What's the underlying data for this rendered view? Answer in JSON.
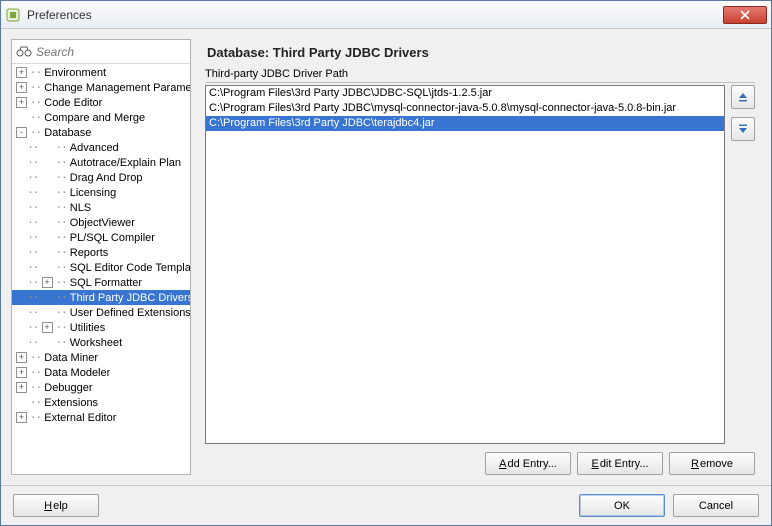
{
  "window": {
    "title": "Preferences"
  },
  "search": {
    "placeholder": "Search"
  },
  "tree": [
    {
      "label": "Environment",
      "level": 0,
      "exp": "+"
    },
    {
      "label": "Change Management Parameters",
      "level": 0,
      "exp": "+"
    },
    {
      "label": "Code Editor",
      "level": 0,
      "exp": "+"
    },
    {
      "label": "Compare and Merge",
      "level": 0,
      "exp": " "
    },
    {
      "label": "Database",
      "level": 0,
      "exp": "-"
    },
    {
      "label": "Advanced",
      "level": 1,
      "exp": " "
    },
    {
      "label": "Autotrace/Explain Plan",
      "level": 1,
      "exp": " "
    },
    {
      "label": "Drag And Drop",
      "level": 1,
      "exp": " "
    },
    {
      "label": "Licensing",
      "level": 1,
      "exp": " "
    },
    {
      "label": "NLS",
      "level": 1,
      "exp": " "
    },
    {
      "label": "ObjectViewer",
      "level": 1,
      "exp": " "
    },
    {
      "label": "PL/SQL Compiler",
      "level": 1,
      "exp": " "
    },
    {
      "label": "Reports",
      "level": 1,
      "exp": " "
    },
    {
      "label": "SQL Editor Code Templates",
      "level": 1,
      "exp": " "
    },
    {
      "label": "SQL Formatter",
      "level": 1,
      "exp": "+"
    },
    {
      "label": "Third Party JDBC Drivers",
      "level": 1,
      "exp": " ",
      "selected": true
    },
    {
      "label": "User Defined Extensions",
      "level": 1,
      "exp": " "
    },
    {
      "label": "Utilities",
      "level": 1,
      "exp": "+"
    },
    {
      "label": "Worksheet",
      "level": 1,
      "exp": " "
    },
    {
      "label": "Data Miner",
      "level": 0,
      "exp": "+"
    },
    {
      "label": "Data Modeler",
      "level": 0,
      "exp": "+"
    },
    {
      "label": "Debugger",
      "level": 0,
      "exp": "+"
    },
    {
      "label": "Extensions",
      "level": 0,
      "exp": " "
    },
    {
      "label": "External Editor",
      "level": 0,
      "exp": "+"
    }
  ],
  "right": {
    "title": "Database: Third Party JDBC Drivers",
    "section": "Third-party JDBC Driver Path",
    "rows": [
      {
        "text": "C:\\Program Files\\3rd Party JDBC\\JDBC-SQL\\jtds-1.2.5.jar"
      },
      {
        "text": "C:\\Program Files\\3rd Party JDBC\\mysql-connector-java-5.0.8\\mysql-connector-java-5.0.8-bin.jar"
      },
      {
        "text": "C:\\Program Files\\3rd Party JDBC\\terajdbc4.jar",
        "selected": true
      }
    ],
    "buttons": {
      "add": "dd Entry...",
      "add_mn": "A",
      "edit": "dit Entry...",
      "edit_mn": "E",
      "remove": "emove",
      "remove_mn": "R"
    }
  },
  "footer": {
    "help": "elp",
    "help_mn": "H",
    "ok": "OK",
    "cancel": "Cancel"
  }
}
